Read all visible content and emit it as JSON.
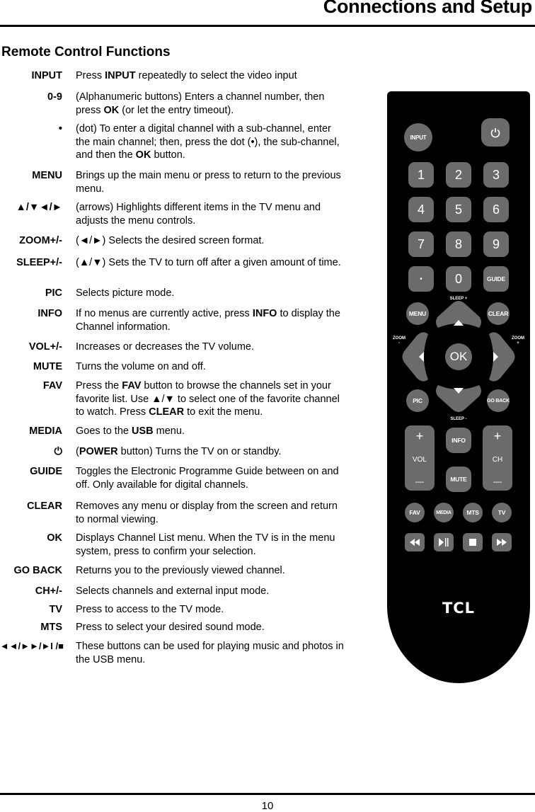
{
  "header": {
    "title": "Connections and Setup"
  },
  "section_title": "Remote Control Functions",
  "entries": [
    {
      "key": "INPUT",
      "desc": "Press <b>INPUT</b> repeatedly to select the video input"
    },
    {
      "key": "0-9",
      "desc": "(Alphanumeric buttons) Enters a channel number, then press <b>OK</b> (or let the entry timeout)."
    },
    {
      "key": "•",
      "desc": "(dot) To enter a digital channel with a sub-channel, enter the main channel; then, press the dot (•), the sub-channel, and then the <b>OK</b> button."
    },
    {
      "key": "MENU",
      "desc": "Brings up the main menu or press to return to the previous menu."
    },
    {
      "key": "▲/▼◄/►",
      "desc": "(arrows) Highlights different items in the TV menu and adjusts the menu controls."
    },
    {
      "key": "ZOOM+/-",
      "desc": "(◄/►) Selects the desired screen format."
    },
    {
      "key": "SLEEP+/-",
      "desc": "(▲/▼) Sets the TV to turn off after a given amount of time."
    },
    {
      "key": "PIC",
      "desc": "Selects picture mode."
    },
    {
      "key": "INFO",
      "desc": "If no menus are currently active, press <b>INFO</b> to display the Channel information."
    },
    {
      "key": "VOL+/-",
      "desc": "Increases or decreases the TV volume."
    },
    {
      "key": "MUTE",
      "desc": "Turns the volume on and off."
    },
    {
      "key": "FAV",
      "desc": "Press the <b>FAV</b> button to browse the channels set in your favorite list. Use ▲/▼ to select one of the favorite channel to watch. Press <b>CLEAR</b> to exit the menu."
    },
    {
      "key": "MEDIA",
      "desc": "Goes to the <b>USB</b> menu."
    },
    {
      "key": "⏻",
      "desc": "(<b>POWER</b> button) Turns the TV on or standby."
    },
    {
      "key": "GUIDE",
      "desc": "Toggles the Electronic Programme Guide between on and off. Only available for digital channels."
    },
    {
      "key": "CLEAR",
      "desc": "Removes any menu or display from the screen and return to normal viewing."
    },
    {
      "key": "OK",
      "desc": "Displays Channel List menu. When the TV is in the menu system, press to confirm your selection."
    },
    {
      "key": "GO BACK",
      "desc": "Returns you to the previously viewed channel."
    },
    {
      "key": "CH+/-",
      "desc": "Selects channels and external input mode."
    },
    {
      "key": "TV",
      "desc": "Press to access to the TV mode."
    },
    {
      "key": "MTS",
      "desc": "Press to select your desired sound mode."
    },
    {
      "key": "◄◄/►►/►I /■",
      "desc": "These buttons can be used for playing music and photos in the USB menu."
    }
  ],
  "remote": {
    "brand": "TCL",
    "input": "INPUT",
    "power_icon": "power-icon",
    "digits": [
      "1",
      "2",
      "3",
      "4",
      "5",
      "6",
      "7",
      "8",
      "9"
    ],
    "dot": "•",
    "zero": "0",
    "guide": "GUIDE",
    "sleep_plus": "SLEEP +",
    "sleep_minus": "SLEEP -",
    "menu": "MENU",
    "clear": "CLEAR",
    "zoom_minus": "ZOOM\n-",
    "zoom_plus": "ZOOM\n+",
    "ok": "OK",
    "pic": "PIC",
    "go_back": "GO BACK",
    "vol": "VOL",
    "ch": "CH",
    "plus": "+",
    "minus": "—",
    "info": "INFO",
    "mute": "MUTE",
    "fav": "FAV",
    "media": "MEDIA",
    "mts": "MTS",
    "tv": "TV"
  },
  "footer": {
    "page_number": "10"
  }
}
